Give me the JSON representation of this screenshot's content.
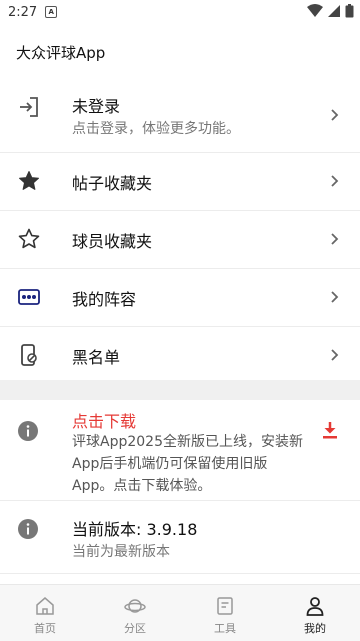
{
  "status_bar": {
    "time": "2:27"
  },
  "app": {
    "title": "大众评球App"
  },
  "menu": {
    "login": {
      "label": "未登录",
      "sub": "点击登录，体验更多功能。"
    },
    "items": [
      {
        "label": "帖子收藏夹",
        "icon": "star-filled-icon"
      },
      {
        "label": "球员收藏夹",
        "icon": "star-outline-icon"
      },
      {
        "label": "我的阵容",
        "icon": "lineup-icon"
      },
      {
        "label": "黑名单",
        "icon": "blocked-phone-icon"
      }
    ]
  },
  "download": {
    "title": "点击下载",
    "desc": "评球App2025全新版已上线，安装新App后手机端仍可保留使用旧版App。点击下载体验。",
    "accent": "#e53935"
  },
  "version": {
    "title": "当前版本: 3.9.18",
    "sub": "当前为最新版本"
  },
  "bottom_nav": {
    "items": [
      {
        "label": "首页",
        "icon": "home-icon"
      },
      {
        "label": "分区",
        "icon": "planet-icon"
      },
      {
        "label": "工具",
        "icon": "tools-icon"
      },
      {
        "label": "我的",
        "icon": "person-icon",
        "active": true
      }
    ]
  }
}
